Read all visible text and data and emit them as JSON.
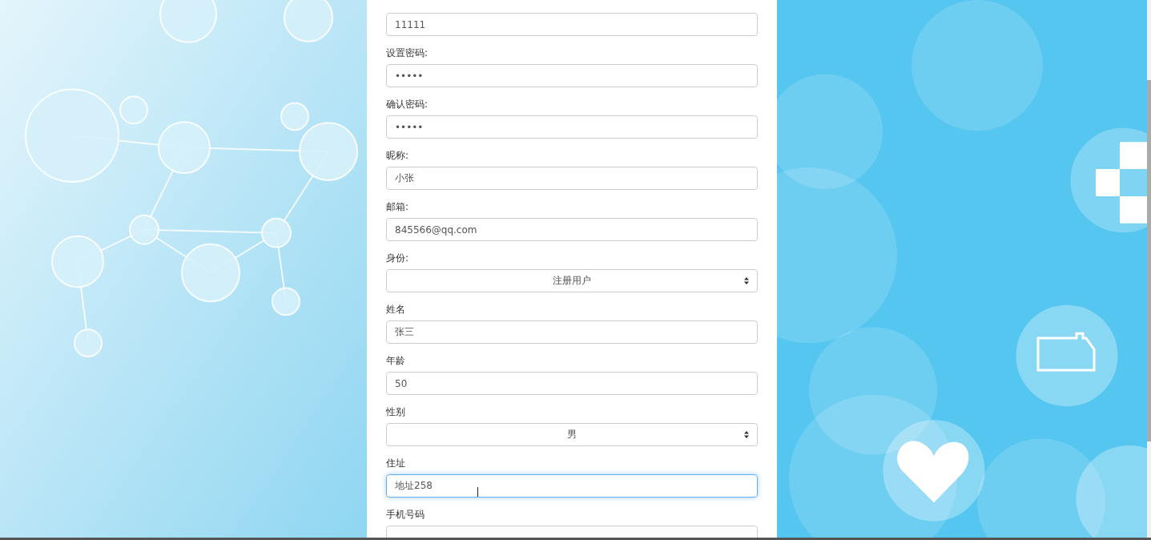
{
  "form": {
    "fields": [
      {
        "kind": "text",
        "value": "11111",
        "focused": false
      },
      {
        "kind": "text",
        "label": "设置密码:",
        "value": "•••••",
        "focused": false
      },
      {
        "kind": "text",
        "label": "确认密码:",
        "value": "•••••",
        "focused": false
      },
      {
        "kind": "text",
        "label": "昵称:",
        "value": "小张",
        "focused": false
      },
      {
        "kind": "text",
        "label": "邮箱:",
        "value": "845566@qq.com",
        "focused": false
      },
      {
        "kind": "select",
        "label": "身份:",
        "value": "注册用户",
        "focused": false
      },
      {
        "kind": "text",
        "label": "姓名",
        "value": "张三",
        "focused": false
      },
      {
        "kind": "text",
        "label": "年龄",
        "value": "50",
        "focused": false
      },
      {
        "kind": "select",
        "label": "性别",
        "value": "男",
        "focused": false
      },
      {
        "kind": "text",
        "label": "住址",
        "value": "地址258",
        "focused": true
      },
      {
        "kind": "text",
        "label": "手机号码",
        "focused": false
      }
    ]
  }
}
